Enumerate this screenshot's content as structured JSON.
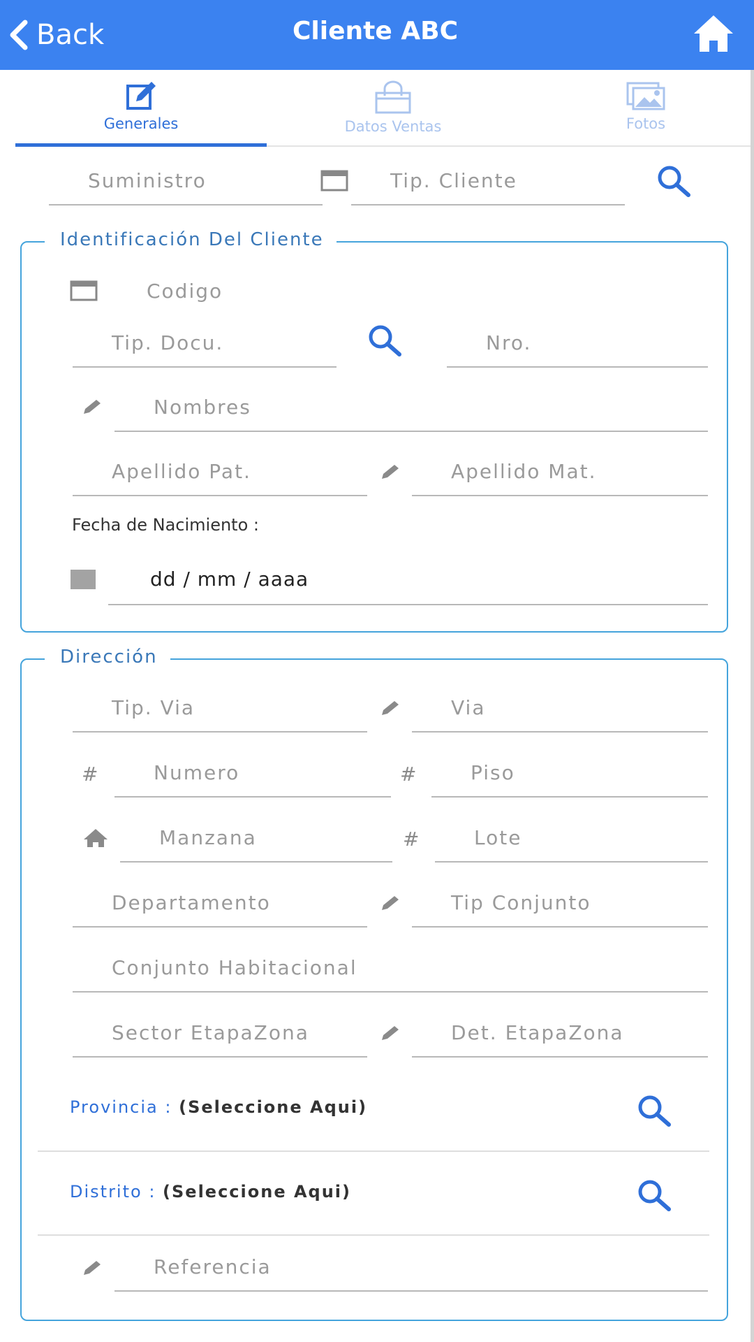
{
  "header": {
    "back_label": "Back",
    "title": "Cliente ABC",
    "bg_color": "#3b82f0"
  },
  "tabs": [
    {
      "label": "Generales",
      "icon": "edit-icon",
      "active": true
    },
    {
      "label": "Datos Ventas",
      "icon": "shopping-bag-icon",
      "active": false
    },
    {
      "label": "Fotos",
      "icon": "images-icon",
      "active": false
    }
  ],
  "top": {
    "suministro_ph": "Suministro",
    "tip_cliente_ph": "Tip. Cliente"
  },
  "identificacion": {
    "legend": "Identificación Del Cliente",
    "codigo_ph": "Codigo",
    "tip_docu_ph": "Tip. Docu.",
    "nro_ph": "Nro.",
    "nombres_ph": "Nombres",
    "apellido_pat_ph": "Apellido Pat.",
    "apellido_mat_ph": "Apellido Mat.",
    "fecha_label": "Fecha de Nacimiento :",
    "fecha_value": "dd / mm / aaaa"
  },
  "direccion": {
    "legend": "Dirección",
    "tip_via_ph": "Tip. Via",
    "via_ph": "Via",
    "numero_ph": "Numero",
    "piso_ph": "Piso",
    "manzana_ph": "Manzana",
    "lote_ph": "Lote",
    "departamento_ph": "Departamento",
    "tip_conjunto_ph": "Tip Conjunto",
    "conjunto_ph": "Conjunto Habitacional",
    "sector_ph": "Sector EtapaZona",
    "det_etapa_ph": "Det. EtapaZona",
    "provincia_label": "Provincia :",
    "provincia_value": "(Seleccione Aqui)",
    "distrito_label": "Distrito :",
    "distrito_value": "(Seleccione Aqui)",
    "referencia_ph": "Referencia",
    "hash_symbol": "#"
  },
  "colors": {
    "accent": "#2f6fd8",
    "border": "#45a4dc",
    "placeholder": "#9a9a9a"
  }
}
